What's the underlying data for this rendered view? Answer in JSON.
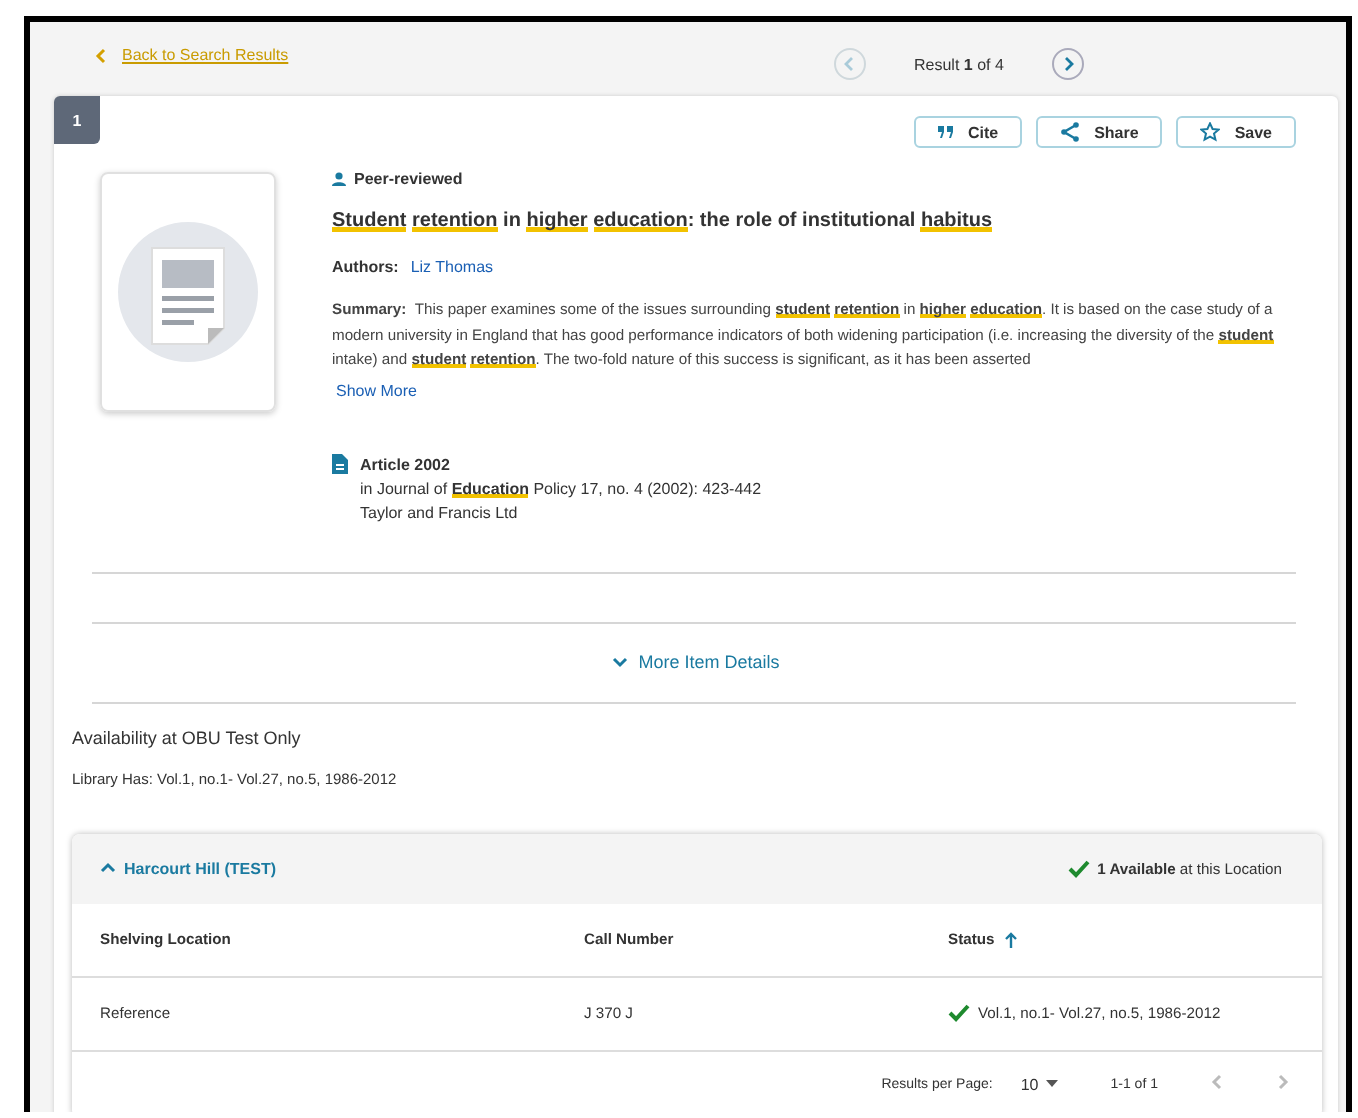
{
  "back_link": "Back to Search Results",
  "pager": {
    "text": "Result **1** of 4",
    "prev_disabled": true,
    "next_disabled": false
  },
  "record": {
    "number": "1",
    "actions": [
      {
        "kind": "cite",
        "label": "Cite"
      },
      {
        "kind": "share",
        "label": "Share"
      },
      {
        "kind": "save",
        "label": "Save"
      }
    ],
    "badge": "Peer-reviewed",
    "title": "**Student** **retention** in **higher** **education**: the role of institutional **habitus**",
    "authors_label": "Authors:",
    "authors": [
      "Liz Thomas"
    ],
    "summary_label": "Summary:",
    "summary": "This paper examines some of the issues surrounding **student** **retention** in **higher** **education**. It is based on the case study of a modern university in England that has good performance indicators of both widening participation (i.e. increasing the diversity of the **student** intake) and **student** **retention**. The two-fold nature of this success is significant, as it has been asserted",
    "show_more": "Show More",
    "type": "Article 2002",
    "source": "in Journal of **Education** Policy 17, no. 4 (2002): 423-442",
    "publisher": "Taylor and Francis Ltd"
  },
  "more_details": "More Item Details",
  "availability": {
    "title": "Availability at OBU Test Only",
    "library_has": "Library Has: Vol.1, no.1- Vol.27, no.5, 1986-2012",
    "locations": [
      {
        "name": "Harcourt Hill (TEST)",
        "expanded": true,
        "summary": "**1 Available** at this Location",
        "columns": [
          {
            "label": "Shelving Location",
            "sorted": false
          },
          {
            "label": "Call Number",
            "sorted": false
          },
          {
            "label": "Status",
            "sorted": true
          }
        ],
        "rows": [
          {
            "cells": [
              "Reference",
              "J 370 J",
              "Vol.1, no.1- Vol.27, no.5, 1986-2012"
            ],
            "available": true
          }
        ],
        "footer": {
          "per_page_label": "Results per Page:",
          "per_page": "10",
          "range": "1-1 of 1",
          "prev_disabled": true,
          "next_disabled": true
        }
      }
    ]
  }
}
